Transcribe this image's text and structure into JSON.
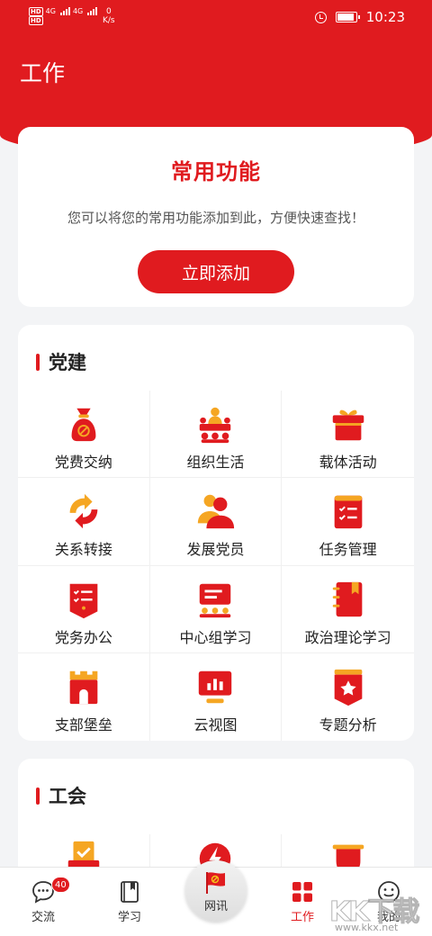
{
  "status_bar": {
    "sig_label_1": "4G",
    "sig_label_2": "4G",
    "speed_value": "0",
    "speed_unit": "K/s",
    "time": "10:23",
    "battery_level": 0.9
  },
  "header": {
    "title": "工作"
  },
  "favorites": {
    "title": "常用功能",
    "description": "您可以将您的常用功能添加到此，方便快速查找！",
    "add_button": "立即添加"
  },
  "party": {
    "title": "党建",
    "items": [
      {
        "label": "党费交纳",
        "icon": "moneybag-icon"
      },
      {
        "label": "组织生活",
        "icon": "meeting-icon"
      },
      {
        "label": "载体活动",
        "icon": "gift-box-icon"
      },
      {
        "label": "关系转接",
        "icon": "transfer-arrows-icon"
      },
      {
        "label": "发展党员",
        "icon": "members-icon"
      },
      {
        "label": "任务管理",
        "icon": "task-list-icon"
      },
      {
        "label": "党务办公",
        "icon": "office-doc-icon"
      },
      {
        "label": "中心组学习",
        "icon": "presentation-icon"
      },
      {
        "label": "政治理论学习",
        "icon": "notebook-icon"
      },
      {
        "label": "支部堡垒",
        "icon": "fortress-icon"
      },
      {
        "label": "云视图",
        "icon": "chart-monitor-icon"
      },
      {
        "label": "专题分析",
        "icon": "star-badge-icon"
      }
    ]
  },
  "union": {
    "title": "工会"
  },
  "tabbar": {
    "tabs": [
      {
        "label": "交流",
        "badge": "40"
      },
      {
        "label": "学习"
      },
      {
        "label": "网讯"
      },
      {
        "label": "工作"
      },
      {
        "label": "我的"
      }
    ],
    "active": "工作"
  },
  "watermark": {
    "logo": "KK下载",
    "url": "www.kkx.net"
  },
  "colors": {
    "brand_red": "#e01b1f",
    "accent_orange": "#f5a623",
    "background": "#f3f4f6"
  }
}
